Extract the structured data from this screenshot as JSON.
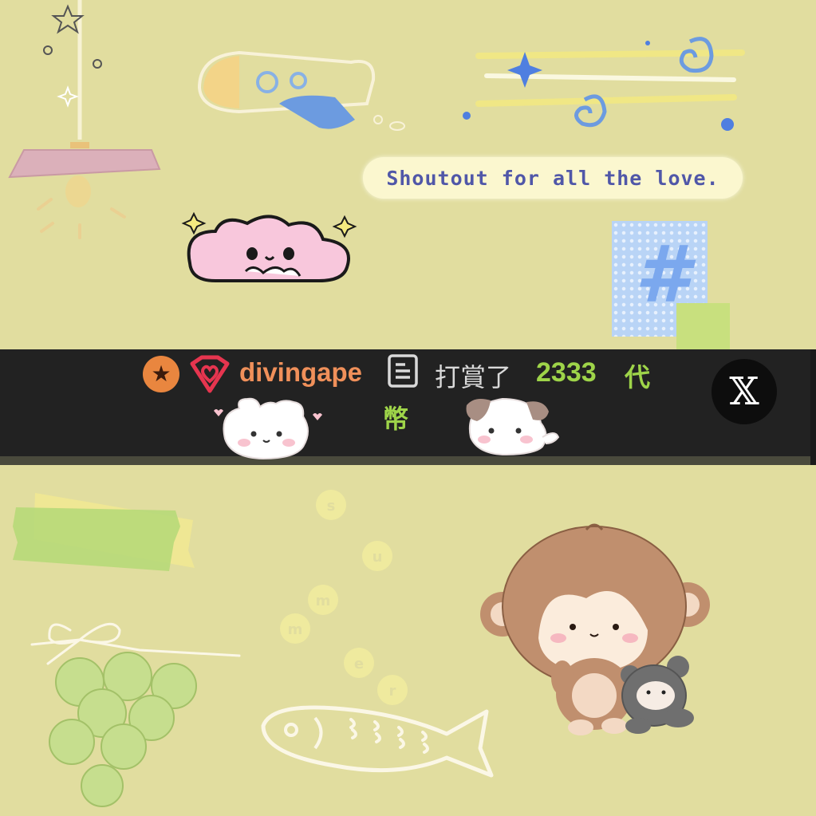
{
  "shoutout": {
    "text": "Shoutout for all the love."
  },
  "hashtag": {
    "symbol": "#"
  },
  "gift_bar": {
    "username": "divingape",
    "tip_text": "打賞了",
    "amount": "2333",
    "currency_part1": "代",
    "currency_part2": "幣",
    "close_label": "𝕏"
  },
  "summer_letters": [
    "s",
    "u",
    "m",
    "m",
    "e",
    "r"
  ],
  "icons": {
    "rank": "star-badge-icon",
    "level": "heart-badge-icon",
    "message": "document-icon",
    "close": "x-logo-icon"
  },
  "colors": {
    "background": "#e1dd9f",
    "bar": "#222222",
    "username": "#f0905a",
    "amount": "#9ed449",
    "shoutout_text": "#5057a8"
  }
}
